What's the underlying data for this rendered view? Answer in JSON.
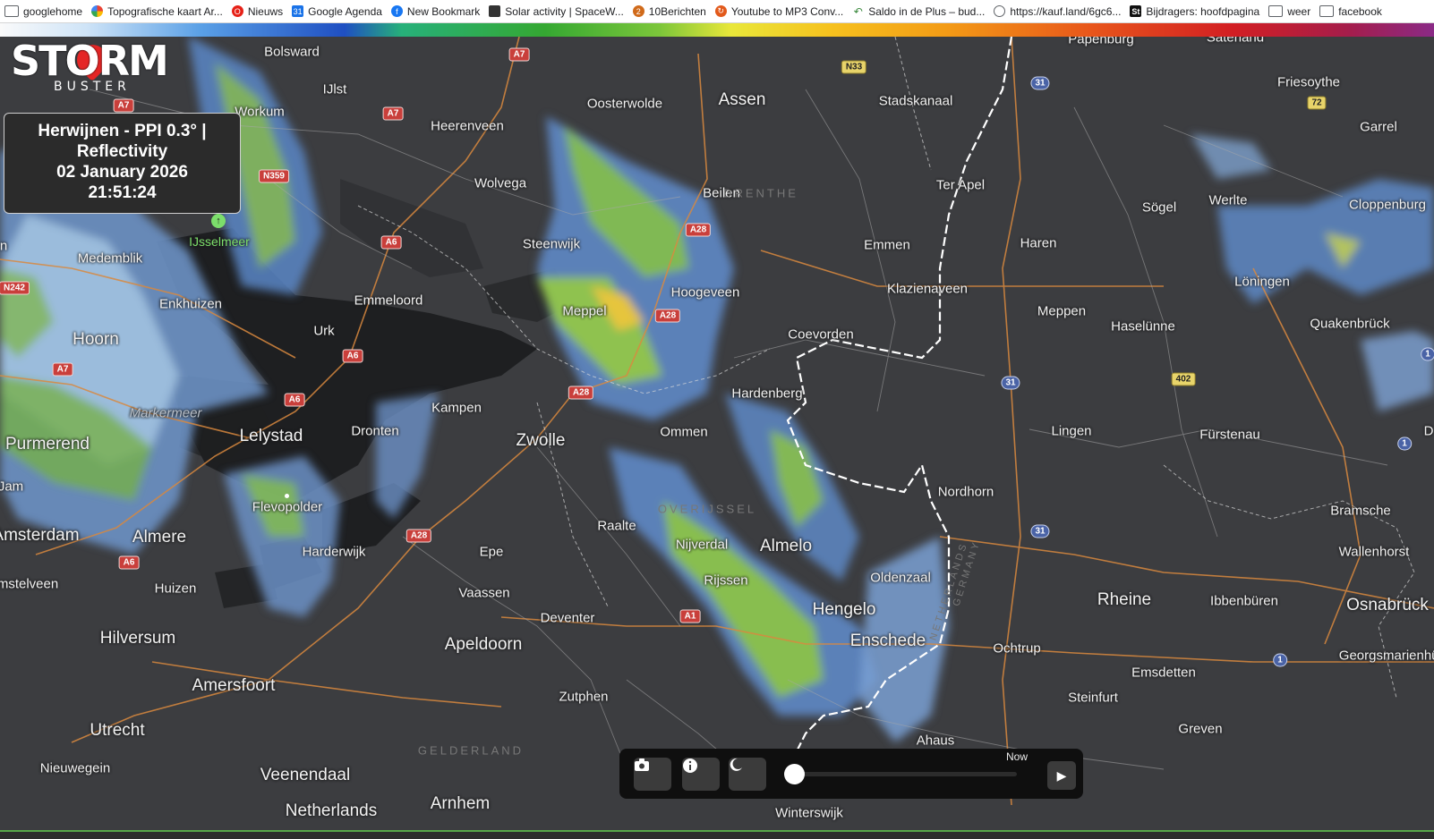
{
  "bookmarks": [
    {
      "label": "googlehome",
      "icon": "folder-icon"
    },
    {
      "label": "Topografische kaart Ar...",
      "icon": "google-icon"
    },
    {
      "label": "Nieuws",
      "icon": "red-circle-icon"
    },
    {
      "label": "Google Agenda",
      "icon": "calendar-icon"
    },
    {
      "label": "New Bookmark",
      "icon": "facebook-icon"
    },
    {
      "label": "Solar activity | SpaceW...",
      "icon": "solar-icon"
    },
    {
      "label": "10Berichten",
      "icon": "number-icon"
    },
    {
      "label": "Youtube to MP3 Conv...",
      "icon": "converter-icon"
    },
    {
      "label": "Saldo in de Plus – bud...",
      "icon": "arrow-icon"
    },
    {
      "label": "https://kauf.land/6gc6...",
      "icon": "globe-icon"
    },
    {
      "label": "Bijdragers: hoofdpagina",
      "icon": "st-icon"
    },
    {
      "label": "weer",
      "icon": "folder-icon"
    },
    {
      "label": "facebook",
      "icon": "folder-icon"
    }
  ],
  "logo": {
    "main": "STORM",
    "sub": "BUSTER"
  },
  "radar_info": {
    "line1": "Herwijnen - PPI 0.3° |",
    "line2": "Reflectivity",
    "date": "02 January 2026",
    "time": "21:51:24"
  },
  "controls": {
    "now_label": "Now"
  },
  "places": [
    {
      "name": "Bolsward"
    },
    {
      "name": "IJlst"
    },
    {
      "name": "Workum"
    },
    {
      "name": "Oosterwolde"
    },
    {
      "name": "Assen"
    },
    {
      "name": "Stadskanaal"
    },
    {
      "name": "Papenburg"
    },
    {
      "name": "Saterland"
    },
    {
      "name": "Friesoythe"
    },
    {
      "name": "Heerenveen"
    },
    {
      "name": "Garrel"
    },
    {
      "name": "Wolvega"
    },
    {
      "name": "Beilen"
    },
    {
      "name": "Ter Apel"
    },
    {
      "name": "Sögel"
    },
    {
      "name": "Werlte"
    },
    {
      "name": "Cloppenburg"
    },
    {
      "name": "IJsselmeer"
    },
    {
      "name": "Steenwijk"
    },
    {
      "name": "Emmen"
    },
    {
      "name": "Haren"
    },
    {
      "name": "Medemblik"
    },
    {
      "name": "Hoogeveen"
    },
    {
      "name": "Klazienaveen"
    },
    {
      "name": "Löningen"
    },
    {
      "name": "Emmeloord"
    },
    {
      "name": "Meppel"
    },
    {
      "name": "Enkhuizen"
    },
    {
      "name": "Meppen"
    },
    {
      "name": "Haselünne"
    },
    {
      "name": "Quakenbrück"
    },
    {
      "name": "Urk"
    },
    {
      "name": "Coevorden"
    },
    {
      "name": "Hoorn"
    },
    {
      "name": "Hardenberg"
    },
    {
      "name": "Markermeer"
    },
    {
      "name": "Kampen"
    },
    {
      "name": "Lingen"
    },
    {
      "name": "Fürstenau"
    },
    {
      "name": "Lelystad"
    },
    {
      "name": "Dronten"
    },
    {
      "name": "Zwolle"
    },
    {
      "name": "Ommen"
    },
    {
      "name": "Purmerend"
    },
    {
      "name": "Nordhorn"
    },
    {
      "name": "Flevopolder"
    },
    {
      "name": "Bramsche"
    },
    {
      "name": "Raalte"
    },
    {
      "name": "Amsterdam"
    },
    {
      "name": "Almere"
    },
    {
      "name": "Nijverdal"
    },
    {
      "name": "Almelo"
    },
    {
      "name": "Wallenhorst"
    },
    {
      "name": "Harderwijk"
    },
    {
      "name": "Epe"
    },
    {
      "name": "Oldenzaal"
    },
    {
      "name": "Rijssen"
    },
    {
      "name": "Huizen"
    },
    {
      "name": "Vaassen"
    },
    {
      "name": "Rheine"
    },
    {
      "name": "Ibbenbüren"
    },
    {
      "name": "Osnabrück"
    },
    {
      "name": "Hengelo"
    },
    {
      "name": "Deventer"
    },
    {
      "name": "Hilversum"
    },
    {
      "name": "Enschede"
    },
    {
      "name": "Ochtrup"
    },
    {
      "name": "Apeldoorn"
    },
    {
      "name": "Georgsmarienhütte"
    },
    {
      "name": "Emsdetten"
    },
    {
      "name": "Amersfoort"
    },
    {
      "name": "Zutphen"
    },
    {
      "name": "Steinfurt"
    },
    {
      "name": "Utrecht"
    },
    {
      "name": "Greven"
    },
    {
      "name": "Ahaus"
    },
    {
      "name": "Nieuwegein"
    },
    {
      "name": "Veenendaal"
    },
    {
      "name": "Arnhem"
    },
    {
      "name": "Netherlands"
    },
    {
      "name": "Winterswijk"
    },
    {
      "name": "Amstelveen"
    },
    {
      "name": "Jam"
    },
    {
      "name": "n"
    }
  ],
  "regions": [
    {
      "name": "DRENTHE"
    },
    {
      "name": "GELDERLAND"
    },
    {
      "name": "OVERIJSSEL"
    },
    {
      "name": "NETHERLANDS"
    },
    {
      "name": "GERMANY"
    }
  ],
  "roads": [
    {
      "ref": "A7"
    },
    {
      "ref": "A7"
    },
    {
      "ref": "A7"
    },
    {
      "ref": "A7"
    },
    {
      "ref": "N33"
    },
    {
      "ref": "31"
    },
    {
      "ref": "72"
    },
    {
      "ref": "N359"
    },
    {
      "ref": "A6"
    },
    {
      "ref": "A28"
    },
    {
      "ref": "N242"
    },
    {
      "ref": "A28"
    },
    {
      "ref": "A6"
    },
    {
      "ref": "A6"
    },
    {
      "ref": "A28"
    },
    {
      "ref": "402"
    },
    {
      "ref": "31"
    },
    {
      "ref": "1"
    },
    {
      "ref": "1"
    },
    {
      "ref": "A28"
    },
    {
      "ref": "31"
    },
    {
      "ref": "A6"
    },
    {
      "ref": "A1"
    },
    {
      "ref": "1"
    },
    {
      "ref": "D"
    }
  ],
  "colors": {
    "map_bg": "#3c3d40",
    "water": "#1e1f21",
    "road_major": "#d9893f",
    "road_minor": "#bcbcbc",
    "border": "#ffffff"
  }
}
